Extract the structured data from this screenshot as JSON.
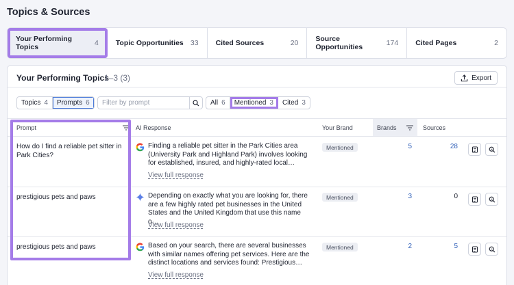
{
  "page_title": "Topics & Sources",
  "tabs": [
    {
      "label": "Your Performing Topics",
      "count": "4",
      "active": true
    },
    {
      "label": "Topic Opportunities",
      "count": "33"
    },
    {
      "label": "Cited Sources",
      "count": "20"
    },
    {
      "label": "Source Opportunities",
      "count": "174"
    },
    {
      "label": "Cited Pages",
      "count": "2"
    }
  ],
  "panel": {
    "title": "Your Performing Topics",
    "range": "1–3 (3)",
    "export_label": "Export"
  },
  "view_toggle": [
    {
      "label": "Topics",
      "count": "4"
    },
    {
      "label": "Prompts",
      "count": "6",
      "active": true
    }
  ],
  "filter": {
    "placeholder": "Filter by prompt",
    "value": ""
  },
  "mention_filter": [
    {
      "label": "All",
      "count": "6"
    },
    {
      "label": "Mentioned",
      "count": "3",
      "active": true
    },
    {
      "label": "Cited",
      "count": "3"
    }
  ],
  "columns": {
    "prompt": "Prompt",
    "ai_response": "AI Response",
    "your_brand": "Your Brand",
    "brands": "Brands",
    "sources": "Sources"
  },
  "rows": [
    {
      "prompt": "How do I find a reliable pet sitter in Park Cities?",
      "engine_icon": "google-icon",
      "response": "Finding a reliable pet sitter in the Park Cities area (University Park and Highland Park) involves looking for established, insured, and highly-rated local…",
      "link": "View full response",
      "brand_status": "Mentioned",
      "brands": "5",
      "sources": "28"
    },
    {
      "prompt": "prestigious pets and paws",
      "engine_icon": "gemini-icon",
      "response": "Depending on exactly what you are looking for, there are a few highly rated pet businesses in the United States and the United Kingdom that use this name o…",
      "link": "View full response",
      "brand_status": "Mentioned",
      "brands": "3",
      "sources": "0"
    },
    {
      "prompt": "prestigious pets and paws",
      "engine_icon": "google-icon",
      "response": "Based on your search, there are several businesses with similar names offering pet services. Here are the distinct locations and services found: Prestigious…",
      "link": "View full response",
      "brand_status": "Mentioned",
      "brands": "2",
      "sources": "5"
    }
  ],
  "colors": {
    "highlight": "#a47ce8",
    "link": "#2f5fb8",
    "background": "#f4f5f9"
  }
}
